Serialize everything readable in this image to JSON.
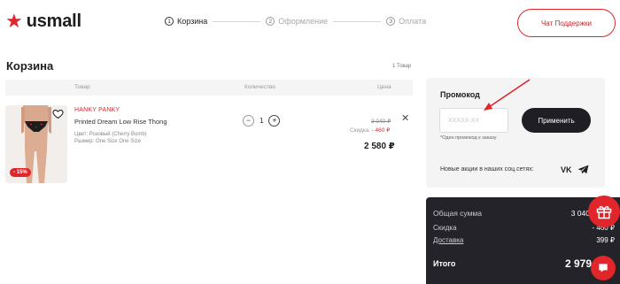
{
  "header": {
    "logo_text": "usmall",
    "steps": [
      {
        "num": "1",
        "label": "Корзина",
        "active": true
      },
      {
        "num": "2",
        "label": "Оформление",
        "active": false
      },
      {
        "num": "3",
        "label": "Оплата",
        "active": false
      }
    ],
    "chat_label": "Чат Поддержки"
  },
  "cart": {
    "title": "Корзина",
    "count": "1 Товар",
    "columns": {
      "product": "Товар",
      "quantity": "Количество",
      "price": "Цена"
    },
    "item": {
      "brand": "HANKY PANKY",
      "name": "Printed Dream Low Rise Thong",
      "color": "Цвет: Розовый (Cherry Bomb)",
      "size": "Размер: One Size One Size",
      "discount_badge": "- 15%",
      "quantity": "1",
      "old_price": "3 040 ₽",
      "discount_label": "Скидка",
      "discount_value": "- 460 ₽",
      "price": "2 580 ₽"
    }
  },
  "promo": {
    "title": "Промокод",
    "placeholder": "XXXXX-XX",
    "note": "*Один промокод к заказу",
    "apply_label": "Применить",
    "social_text": "Новые акции в наших соц.сетях:",
    "vk_label": "VK"
  },
  "summary": {
    "total_label": "Общая сумма",
    "total_value": "3 040",
    "discount_label": "Скидка",
    "discount_value": "- 460 ₽",
    "delivery_label": "Доставка",
    "delivery_value": "399 ₽",
    "grand_label": "Итого",
    "grand_value": "2 979"
  },
  "colors": {
    "accent": "#e0262b",
    "dark": "#232329",
    "panel": "#f4f4f4"
  }
}
